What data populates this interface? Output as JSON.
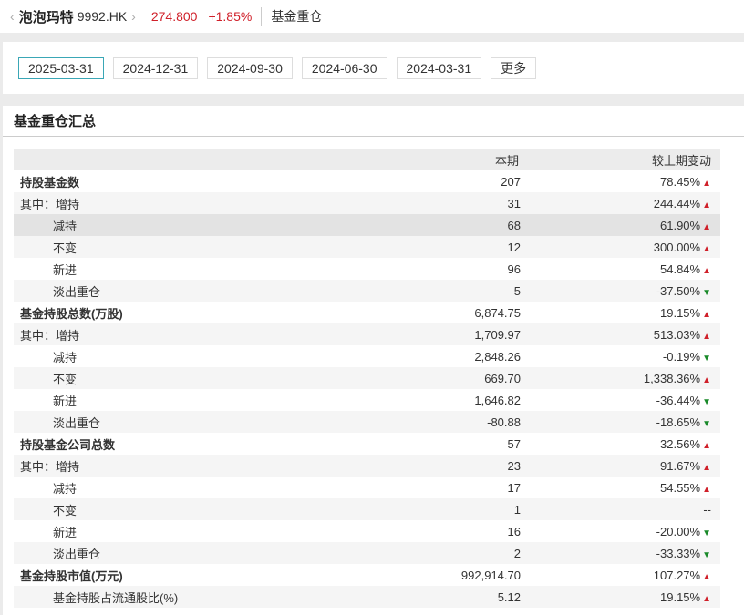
{
  "header": {
    "name": "泡泡玛特",
    "code": "9992.HK",
    "price": "274.800",
    "change": "+1.85%",
    "tab": "基金重仓"
  },
  "dates": [
    "2025-03-31",
    "2024-12-31",
    "2024-09-30",
    "2024-06-30",
    "2024-03-31"
  ],
  "more": "更多",
  "section_title": "基金重仓汇总",
  "columns": [
    "",
    "本期",
    "较上期变动"
  ],
  "rows": [
    {
      "label": "持股基金数",
      "value": "207",
      "change": "78.45%",
      "dir": "up",
      "bold": true
    },
    {
      "label": "其中：增持",
      "value": "31",
      "change": "244.44%",
      "dir": "up"
    },
    {
      "label": "减持",
      "value": "68",
      "change": "61.90%",
      "dir": "up",
      "indent": true
    },
    {
      "label": "不变",
      "value": "12",
      "change": "300.00%",
      "dir": "up",
      "indent": true
    },
    {
      "label": "新进",
      "value": "96",
      "change": "54.84%",
      "dir": "up",
      "indent": true
    },
    {
      "label": "淡出重仓",
      "value": "5",
      "change": "-37.50%",
      "dir": "down",
      "indent": true
    },
    {
      "label": "基金持股总数(万股)",
      "value": "6,874.75",
      "change": "19.15%",
      "dir": "up",
      "bold": true
    },
    {
      "label": "其中：增持",
      "value": "1,709.97",
      "change": "513.03%",
      "dir": "up"
    },
    {
      "label": "减持",
      "value": "2,848.26",
      "change": "-0.19%",
      "dir": "down",
      "indent": true
    },
    {
      "label": "不变",
      "value": "669.70",
      "change": "1,338.36%",
      "dir": "up",
      "indent": true
    },
    {
      "label": "新进",
      "value": "1,646.82",
      "change": "-36.44%",
      "dir": "down",
      "indent": true
    },
    {
      "label": "淡出重仓",
      "value": "-80.88",
      "change": "-18.65%",
      "dir": "down",
      "indent": true
    },
    {
      "label": "持股基金公司总数",
      "value": "57",
      "change": "32.56%",
      "dir": "up",
      "bold": true
    },
    {
      "label": "其中：增持",
      "value": "23",
      "change": "91.67%",
      "dir": "up"
    },
    {
      "label": "减持",
      "value": "17",
      "change": "54.55%",
      "dir": "up",
      "indent": true
    },
    {
      "label": "不变",
      "value": "1",
      "change": "--",
      "dir": "none",
      "indent": true
    },
    {
      "label": "新进",
      "value": "16",
      "change": "-20.00%",
      "dir": "down",
      "indent": true
    },
    {
      "label": "淡出重仓",
      "value": "2",
      "change": "-33.33%",
      "dir": "down",
      "indent": true
    },
    {
      "label": "基金持股市值(万元)",
      "value": "992,914.70",
      "change": "107.27%",
      "dir": "up",
      "bold": true
    },
    {
      "label": "基金持股占流通股比(%)",
      "value": "5.12",
      "change": "19.15%",
      "dir": "up",
      "indent": true
    }
  ],
  "colors": {
    "up": "#d0202a",
    "down": "#1a8a2a",
    "active_border": "#3aa7b6"
  }
}
